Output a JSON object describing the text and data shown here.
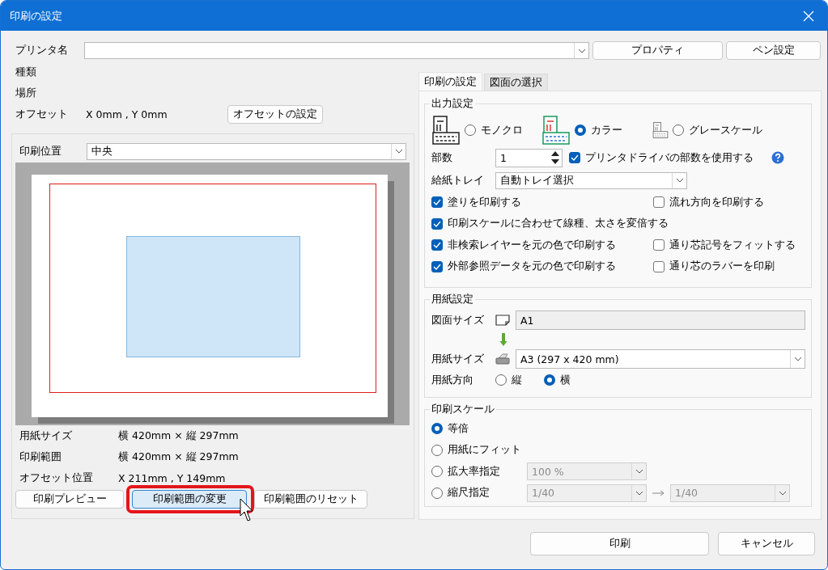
{
  "window": {
    "title": "印刷の設定"
  },
  "printer": {
    "label": "プリンタ名",
    "buttons": [
      "プロパティ",
      "ペン設定"
    ]
  },
  "info": [
    {
      "label": "種類"
    },
    {
      "label": "場所"
    },
    {
      "label": "オフセット",
      "value": "X 0mm , Y 0mm",
      "button": "オフセットの設定"
    }
  ],
  "print_position": {
    "label": "印刷位置",
    "value": "中央"
  },
  "details": [
    {
      "label": "用紙サイズ",
      "value": "横 420mm × 縦 297mm"
    },
    {
      "label": "印刷範囲",
      "value": "横 420mm × 縦 297mm"
    },
    {
      "label": "オフセット位置",
      "value": "X 211mm , Y 149mm"
    }
  ],
  "preview_buttons": [
    {
      "label": "印刷プレビュー",
      "highlighted": false
    },
    {
      "label": "印刷範囲の変更",
      "highlighted": true
    },
    {
      "label": "印刷範囲のリセット",
      "highlighted": false
    }
  ],
  "tabs": [
    {
      "label": "印刷の設定",
      "selected": true
    },
    {
      "label": "図面の選択",
      "selected": false
    }
  ],
  "output_settings": {
    "title": "出力設定",
    "color_modes": [
      {
        "kind": "mono",
        "label": "モノクロ",
        "selected": false
      },
      {
        "kind": "color",
        "label": "カラー",
        "selected": true
      },
      {
        "kind": "gray",
        "label": "グレースケール",
        "selected": false
      }
    ],
    "copies": {
      "label": "部数",
      "value": "1"
    },
    "driver_copies": {
      "label": "プリンタドライバの部数を使用する",
      "checked": true
    },
    "tray": {
      "label": "給紙トレイ",
      "value": "自動トレイ選択"
    },
    "option_rows": [
      {
        "items": [
          {
            "label": "塗りを印刷する",
            "checked": true
          },
          {
            "label": "流れ方向を印刷する",
            "checked": false
          }
        ]
      },
      {
        "items": [
          {
            "label": "印刷スケールに合わせて線種、太さを変倍する",
            "checked": true
          }
        ]
      },
      {
        "items": [
          {
            "label": "非検索レイヤーを元の色で印刷する",
            "checked": true
          },
          {
            "label": "通り芯記号をフィットする",
            "checked": false
          }
        ]
      },
      {
        "items": [
          {
            "label": "外部参照データを元の色で印刷する",
            "checked": true
          },
          {
            "label": "通り芯のラバーを印刷",
            "checked": false
          }
        ]
      }
    ]
  },
  "paper_settings": {
    "title": "用紙設定",
    "drawing_size": {
      "label": "図面サイズ",
      "value": "A1"
    },
    "paper_size": {
      "label": "用紙サイズ",
      "value": "A3 (297 x 420 mm)"
    },
    "orientation": {
      "label": "用紙方向",
      "options": [
        {
          "label": "縦",
          "selected": false
        },
        {
          "label": "横",
          "selected": true
        }
      ]
    }
  },
  "print_scale": {
    "title": "印刷スケール",
    "options": [
      {
        "kind": "plain",
        "label": "等倍",
        "selected": true
      },
      {
        "kind": "plain",
        "label": "用紙にフィット",
        "selected": false
      },
      {
        "kind": "ratio",
        "label": "拡大率指定",
        "selected": false,
        "value": "100 %",
        "disabled": true
      },
      {
        "kind": "scale",
        "label": "縮尺指定",
        "selected": false,
        "from": "1/40",
        "to": "1/40",
        "disabled": true
      }
    ]
  },
  "footer_buttons": [
    "印刷",
    "キャンセル"
  ]
}
